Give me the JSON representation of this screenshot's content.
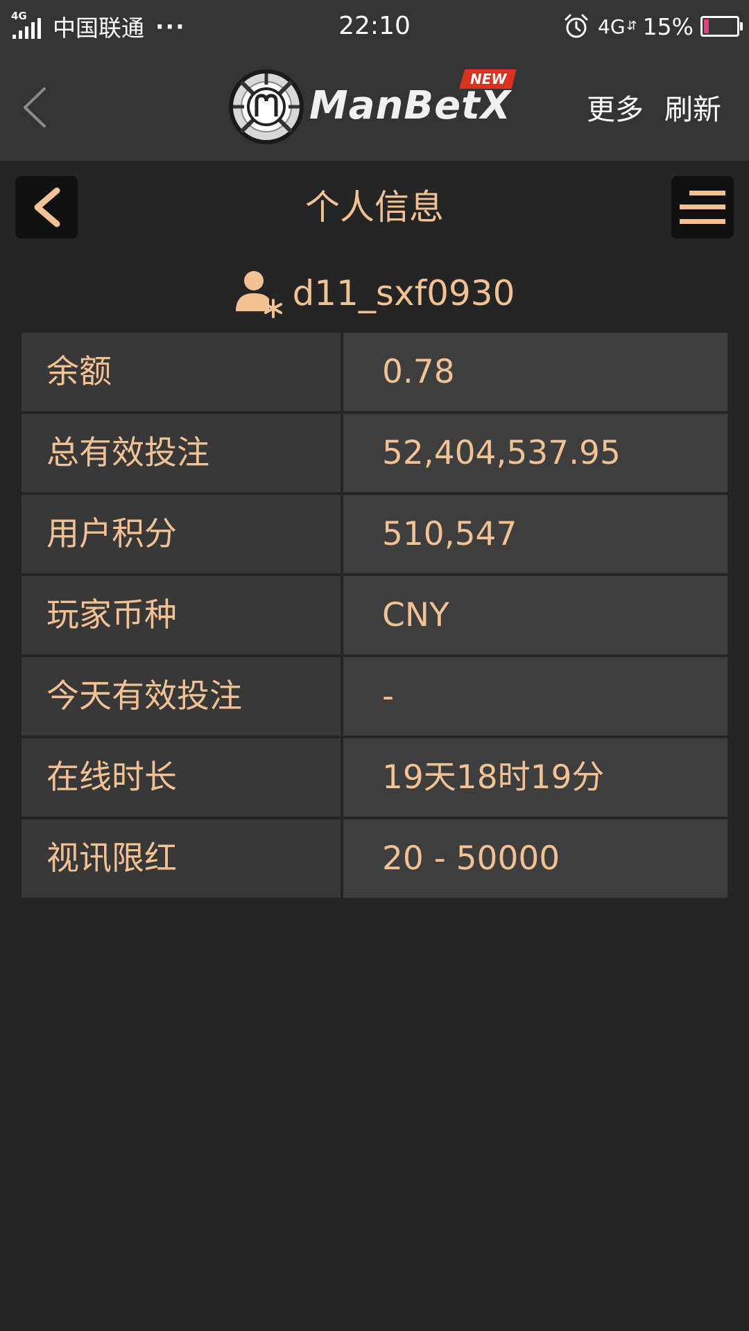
{
  "status_bar": {
    "network_small": "4G",
    "carrier": "中国联通",
    "dots": "···",
    "time": "22:10",
    "net_type": "4G",
    "arrows": "⇵",
    "battery_pct": "15%",
    "battery_level": 0.15
  },
  "header": {
    "logo_text": "ManBetX",
    "logo_badge": "NEW",
    "more_label": "更多",
    "refresh_label": "刷新"
  },
  "page": {
    "title": "个人信息",
    "username": "d11_sxf0930"
  },
  "info_rows": [
    {
      "label": "余额",
      "value": "0.78"
    },
    {
      "label": "总有效投注",
      "value": "52,404,537.95"
    },
    {
      "label": "用户积分",
      "value": "510,547"
    },
    {
      "label": "玩家币种",
      "value": "CNY"
    },
    {
      "label": "今天有效投注",
      "value": "-"
    },
    {
      "label": "在线时长",
      "value": "19天18时19分"
    },
    {
      "label": "视讯限红",
      "value": "20 - 50000"
    }
  ],
  "colors": {
    "accent": "#f3c294",
    "header_bg": "#343434",
    "page_bg": "#252525",
    "battery_low": "#f23b7f",
    "badge": "#d9331f"
  }
}
